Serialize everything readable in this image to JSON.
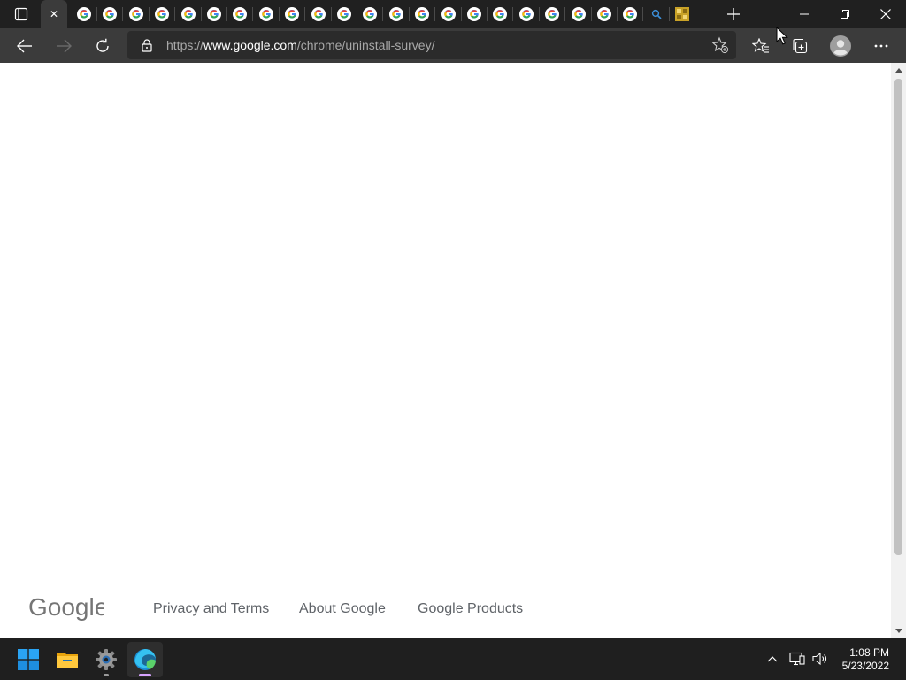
{
  "browser": {
    "active_tab": {
      "close_glyph": "✕"
    },
    "tabs": [
      {
        "icon": "google-g"
      },
      {
        "icon": "google-g"
      },
      {
        "icon": "google-g"
      },
      {
        "icon": "google-g"
      },
      {
        "icon": "google-g"
      },
      {
        "icon": "google-g"
      },
      {
        "icon": "google-g"
      },
      {
        "icon": "google-g"
      },
      {
        "icon": "google-g"
      },
      {
        "icon": "google-g"
      },
      {
        "icon": "google-g"
      },
      {
        "icon": "google-g"
      },
      {
        "icon": "google-g"
      },
      {
        "icon": "google-g"
      },
      {
        "icon": "google-g"
      },
      {
        "icon": "google-g"
      },
      {
        "icon": "google-g"
      },
      {
        "icon": "google-g"
      },
      {
        "icon": "google-g"
      },
      {
        "icon": "google-g"
      },
      {
        "icon": "google-g"
      },
      {
        "icon": "google-g"
      },
      {
        "icon": "search"
      },
      {
        "icon": "image"
      }
    ],
    "address": {
      "scheme": "https://",
      "host": "www.google.com",
      "path": "/chrome/uninstall-survey/"
    }
  },
  "page": {
    "logo_text": "Google",
    "footer_links": [
      {
        "label": "Privacy and Terms"
      },
      {
        "label": "About Google"
      },
      {
        "label": "Google Products"
      }
    ]
  },
  "taskbar": {
    "apps": [
      "start-icon",
      "file-explorer-icon",
      "settings-icon",
      "edge-icon"
    ],
    "time": "1:08 PM",
    "date": "5/23/2022"
  },
  "colors": {
    "tabstrip_bg": "#202020",
    "toolbar_bg": "#3b3b3b",
    "page_bg": "#ffffff",
    "footer_link": "#5f6368",
    "taskbar_bg": "#1f1f1f"
  }
}
